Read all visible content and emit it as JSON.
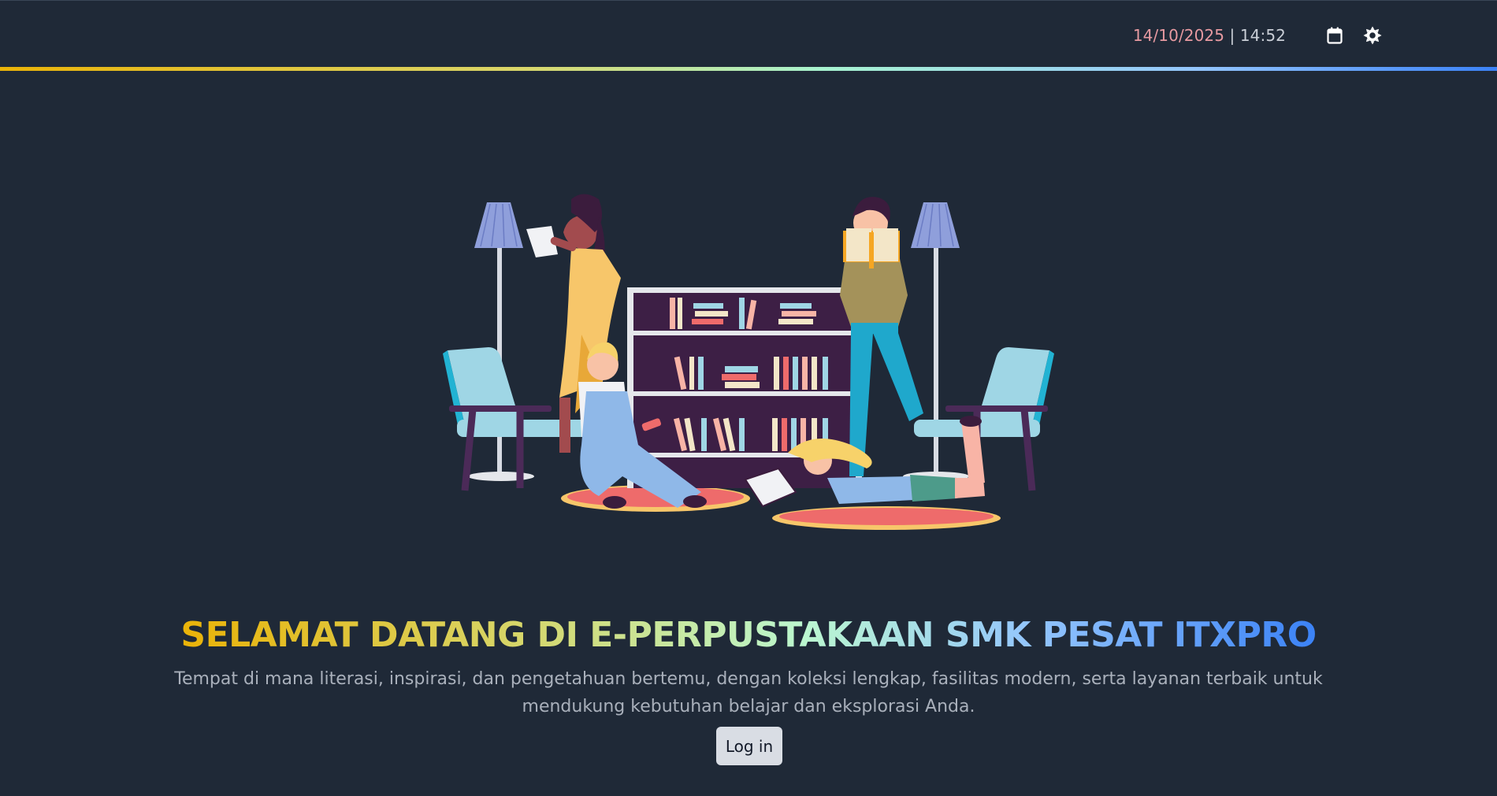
{
  "header": {
    "date": "14/10/2025",
    "separator": " | ",
    "time": "14:52",
    "calendar_icon": "calendar-icon",
    "theme_icon": "sun-icon"
  },
  "hero": {
    "title": "SELAMAT DATANG DI E-PERPUSTAKAAN SMK PESAT ITXPRO",
    "subtitle": "Tempat di mana literasi, inspirasi, dan pengetahuan bertemu, dengan koleksi lengkap, fasilitas modern, serta layanan terbaik untuk mendukung kebutuhan belajar dan eksplorasi Anda.",
    "login_label": "Log in"
  },
  "colors": {
    "background": "#1f2937",
    "gradient_start": "#eab308",
    "gradient_end": "#3b82f6",
    "date_accent": "#e79aa1"
  }
}
